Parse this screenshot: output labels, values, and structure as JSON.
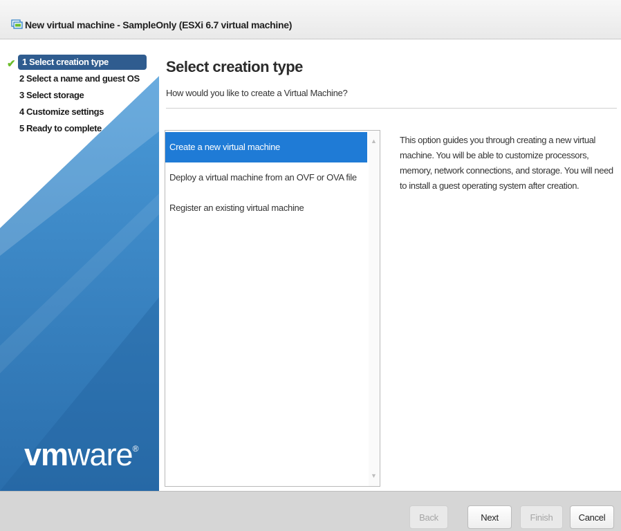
{
  "window": {
    "title": "New virtual machine - SampleOnly (ESXi 6.7 virtual machine)"
  },
  "sidebar": {
    "steps": [
      {
        "label": "1 Select creation type",
        "state": "active-complete"
      },
      {
        "label": "2 Select a name and guest OS",
        "state": "pending"
      },
      {
        "label": "3 Select storage",
        "state": "pending"
      },
      {
        "label": "4 Customize settings",
        "state": "pending"
      },
      {
        "label": "5 Ready to complete",
        "state": "pending"
      }
    ],
    "check_icon": "✔",
    "logo": {
      "vm": "vm",
      "ware": "ware",
      "reg": "®"
    }
  },
  "main": {
    "title": "Select creation type",
    "subtitle": "How would you like to create a Virtual Machine?",
    "options": [
      {
        "label": "Create a new virtual machine",
        "selected": true
      },
      {
        "label": "Deploy a virtual machine from an OVF or OVA file",
        "selected": false
      },
      {
        "label": "Register an existing virtual machine",
        "selected": false
      }
    ],
    "description": "This option guides you through creating a new virtual machine. You will be able to customize processors, memory, network connections, and storage. You will need to install a guest operating system after creation."
  },
  "footer": {
    "back_label": "Back",
    "next_label": "Next",
    "finish_label": "Finish",
    "cancel_label": "Cancel"
  },
  "colors": {
    "active_step_bg": "#2f5c8f",
    "selected_option_bg": "#1f7bd6",
    "sidebar_blue": "#2c6fab",
    "check_green": "#6bbd2a"
  }
}
